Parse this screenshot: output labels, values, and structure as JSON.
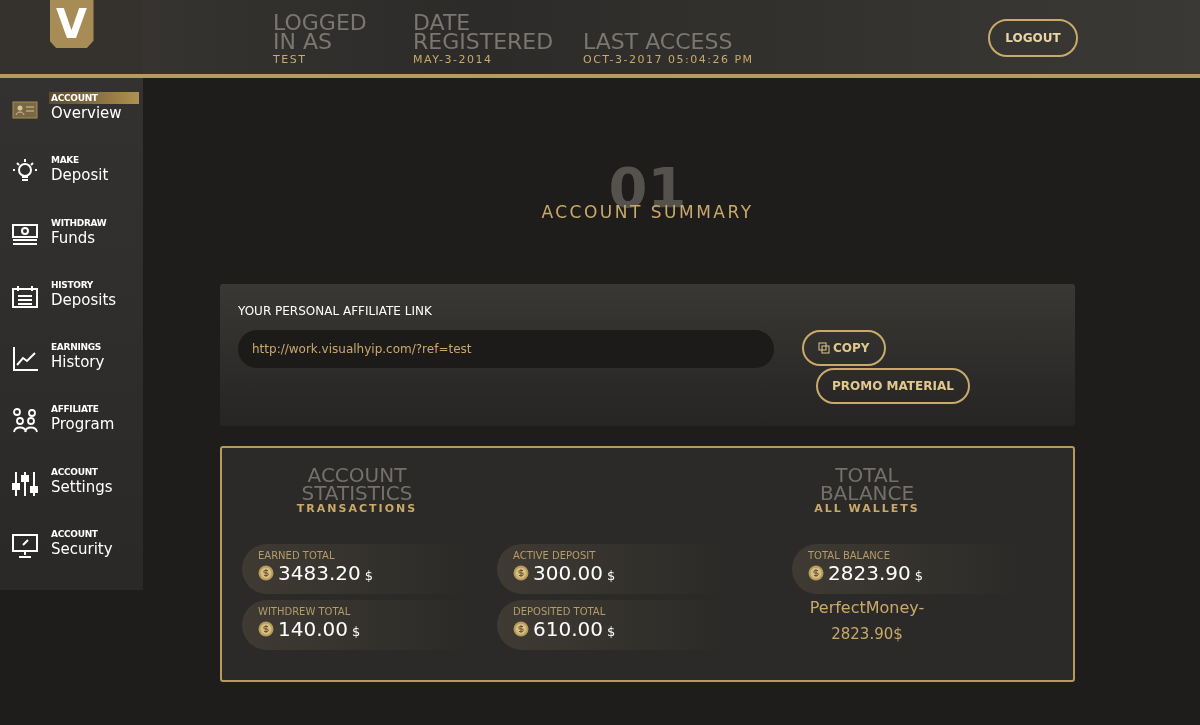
{
  "header": {
    "logo": "V",
    "info": [
      {
        "label": "LOGGED IN AS",
        "value": "TEST"
      },
      {
        "label": "DATE REGISTERED",
        "value": "MAY-3-2014"
      },
      {
        "label": "LAST ACCESS",
        "value": "OCT-3-2017 05:04:26 PM"
      }
    ],
    "logout": "LOGOUT"
  },
  "sidebar": {
    "items": [
      {
        "caption": "ACCOUNT",
        "label": "Overview",
        "selected": true
      },
      {
        "caption": "MAKE",
        "label": "Deposit",
        "selected": false
      },
      {
        "caption": "WITHDRAW",
        "label": "Funds",
        "selected": false
      },
      {
        "caption": "HISTORY",
        "label": "Deposits",
        "selected": false
      },
      {
        "caption": "EARNINGS",
        "label": "History",
        "selected": false
      },
      {
        "caption": "AFFILIATE",
        "label": "Program",
        "selected": false
      },
      {
        "caption": "ACCOUNT",
        "label": "Settings",
        "selected": false
      },
      {
        "caption": "ACCOUNT",
        "label": "Security",
        "selected": false
      }
    ]
  },
  "section": {
    "number": "01",
    "title": "ACCOUNT SUMMARY"
  },
  "affiliate": {
    "label": "YOUR PERSONAL AFFILIATE LINK",
    "link": "http://work.visualhyip.com/?ref=test",
    "copy": "COPY",
    "promo": "PROMO MATERIAL"
  },
  "statistics": {
    "title": "ACCOUNT STATISTICS",
    "subtitle": "TRANSACTIONS",
    "stats": [
      {
        "label": "EARNED TOTAL",
        "value": "3483.20",
        "currency": "$"
      },
      {
        "label": "ACTIVE DEPOSIT",
        "value": "300.00",
        "currency": "$"
      },
      {
        "label": "WITHDREW TOTAL",
        "value": "140.00",
        "currency": "$"
      },
      {
        "label": "DEPOSITED TOTAL",
        "value": "610.00",
        "currency": "$"
      }
    ]
  },
  "balance": {
    "title": "TOTAL BALANCE",
    "subtitle": "ALL WALLETS",
    "label": "TOTAL BALANCE",
    "value": "2823.90",
    "currency": "$",
    "wallets": [
      {
        "name": "PerfectMoney-",
        "value": "2823.90",
        "currency": "$"
      }
    ]
  }
}
